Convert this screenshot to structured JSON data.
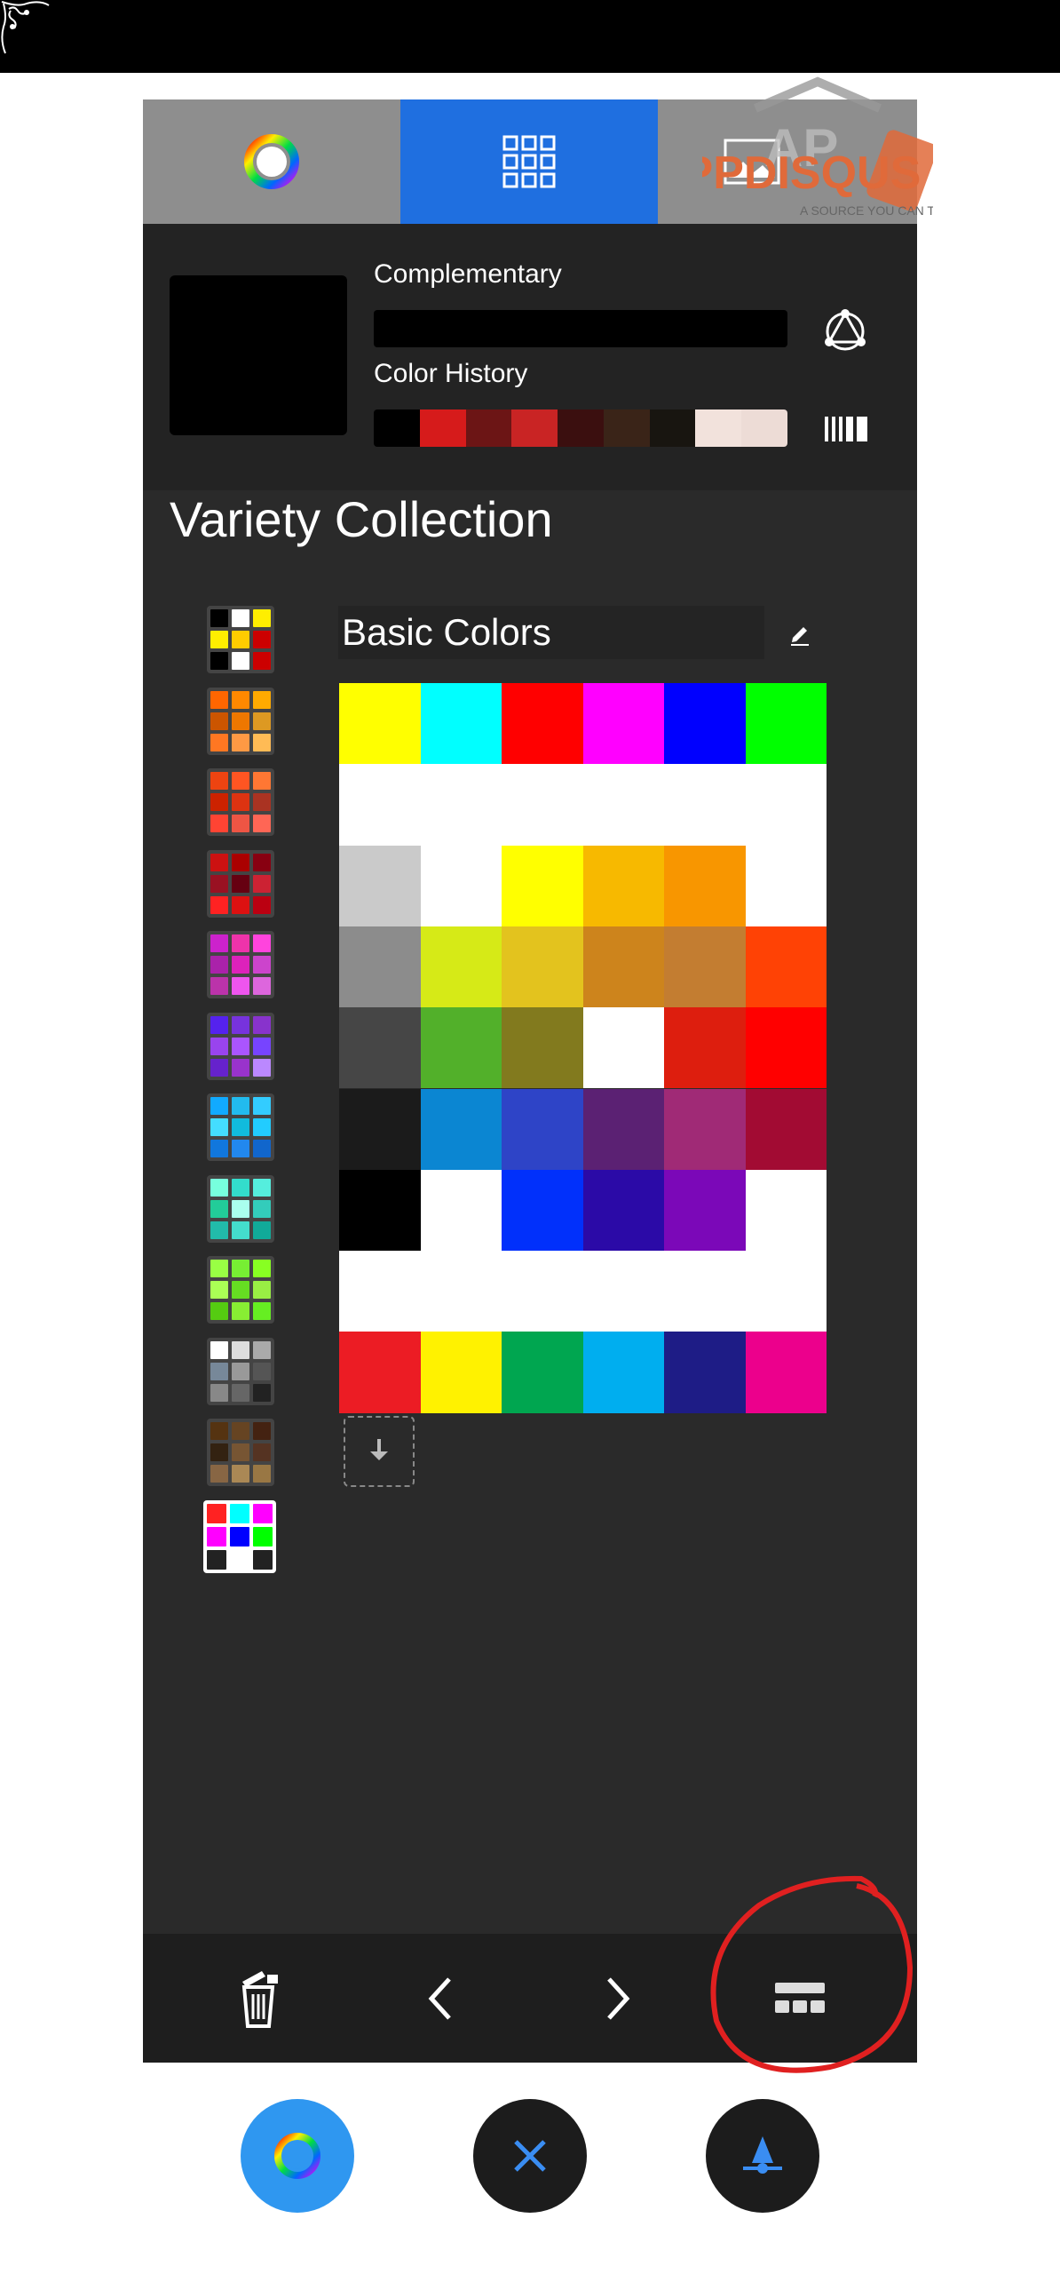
{
  "tabs": [
    {
      "name": "color-wheel",
      "icon": "color-wheel-icon"
    },
    {
      "name": "palette",
      "icon": "grid-icon",
      "active": true
    },
    {
      "name": "image",
      "icon": "image-icon"
    }
  ],
  "watermark": {
    "text": "APPDISQUS",
    "tagline": "A SOURCE YOU CAN TRUST"
  },
  "info": {
    "complementary_label": "Complementary",
    "complementary_color": "#000000",
    "history_label": "Color History",
    "current_color": "#000000",
    "history_colors": [
      "#000000",
      "#d61b1b",
      "#6c1515",
      "#c92424",
      "#3b0f0f",
      "#3a2418",
      "#181510",
      "#f2e2dc",
      "#eddcd6"
    ]
  },
  "collection": {
    "title": "Variety Collection",
    "palette_name": "Basic Colors",
    "thumbnails": [
      [
        "#000000",
        "#ffffff",
        "#ffee00",
        "#ffee00",
        "#ffcc00",
        "#cc0000",
        "#000000",
        "#ffffff",
        "#cc0000"
      ],
      [
        "#ff6600",
        "#ff8800",
        "#ffaa00",
        "#cc5500",
        "#ee7700",
        "#dd9922",
        "#ff7722",
        "#ff9944",
        "#ffbb55"
      ],
      [
        "#ee4411",
        "#ff5522",
        "#ff7733",
        "#cc2200",
        "#dd3311",
        "#aa3322",
        "#ff4433",
        "#ee5544",
        "#ff6655"
      ],
      [
        "#cc1111",
        "#aa0000",
        "#880011",
        "#991122",
        "#660011",
        "#cc2233",
        "#ff2222",
        "#dd1111",
        "#bb0011"
      ],
      [
        "#cc22cc",
        "#ee33aa",
        "#ff44dd",
        "#aa22aa",
        "#dd22bb",
        "#cc44cc",
        "#bb33aa",
        "#ee55ee",
        "#dd66dd"
      ],
      [
        "#5522ee",
        "#7733dd",
        "#8833cc",
        "#9944ee",
        "#aa55ff",
        "#7744ff",
        "#6622cc",
        "#9933cc",
        "#bb88ff"
      ],
      [
        "#11aaff",
        "#22bbee",
        "#33ccff",
        "#44ddff",
        "#11bbdd",
        "#22ccff",
        "#1177dd",
        "#2288ee",
        "#1166cc"
      ],
      [
        "#77ffdd",
        "#33ddcc",
        "#55eedd",
        "#22cc99",
        "#aaffee",
        "#33ccbb",
        "#22bbaa",
        "#44ddcc",
        "#11aa99"
      ],
      [
        "#99ff44",
        "#77ee33",
        "#88ff22",
        "#aaff55",
        "#66dd22",
        "#99ee44",
        "#55cc11",
        "#88ee33",
        "#66ee22"
      ],
      [
        "#ffffff",
        "#dddddd",
        "#aaaaaa",
        "#778899",
        "#999999",
        "#555555",
        "#888888",
        "#666666",
        "#222222"
      ],
      [
        "#553311",
        "#664422",
        "#442211",
        "#332211",
        "#775533",
        "#553322",
        "#886644",
        "#aa8855",
        "#997744"
      ],
      [
        "#ff2222",
        "#00ffff",
        "#ff00ff",
        "#ff00ff",
        "#0000ff",
        "#00ff00",
        "#222222",
        "#ffffff",
        "#222222"
      ]
    ],
    "selected_thumbnail": 11,
    "grid": [
      [
        "#ffff00",
        "#00ffff",
        "#ff0000",
        "#ff00ff",
        "#0000ff",
        "#00ff00"
      ],
      [
        "#ffffff",
        "#ffffff",
        "#ffffff",
        "#ffffff",
        "#ffffff",
        "#ffffff"
      ],
      [
        "#cacaca",
        "#ffffff",
        "#ffff00",
        "#f7b900",
        "#f89600",
        "#ffffff"
      ],
      [
        "#8c8c8c",
        "#d6ea17",
        "#e3c31e",
        "#cd841c",
        "#c37d31",
        "#ff4205"
      ],
      [
        "#464646",
        "#52b02a",
        "#827a1e",
        "#ffffff",
        "#dd1e0e",
        "#ff0000"
      ],
      [
        "#1b1b1b",
        "#0b86d2",
        "#2e44c7",
        "#5b2173",
        "#a02a76",
        "#a20b33"
      ],
      [
        "#000000",
        "#ffffff",
        "#0130fb",
        "#2b0aa7",
        "#7b08b8",
        "#ffffff"
      ],
      [
        "#ffffff",
        "#ffffff",
        "#ffffff",
        "#ffffff",
        "#ffffff",
        "#ffffff"
      ],
      [
        "#ec1c24",
        "#fff200",
        "#00a650",
        "#00aeef",
        "#1e1c86",
        "#ec008c"
      ]
    ]
  },
  "toolbar": [
    "delete-icon",
    "chevron-left-icon",
    "chevron-right-icon",
    "layout-icon"
  ],
  "fabs": [
    {
      "icon": "color-wheel-icon",
      "bg": "#2f97f0"
    },
    {
      "icon": "close-icon",
      "bg": "#1c1c1c"
    },
    {
      "icon": "eyedropper-icon",
      "bg": "#1c1c1c"
    }
  ],
  "accent": "#1f6fe0",
  "annotation_color": "#e02020"
}
